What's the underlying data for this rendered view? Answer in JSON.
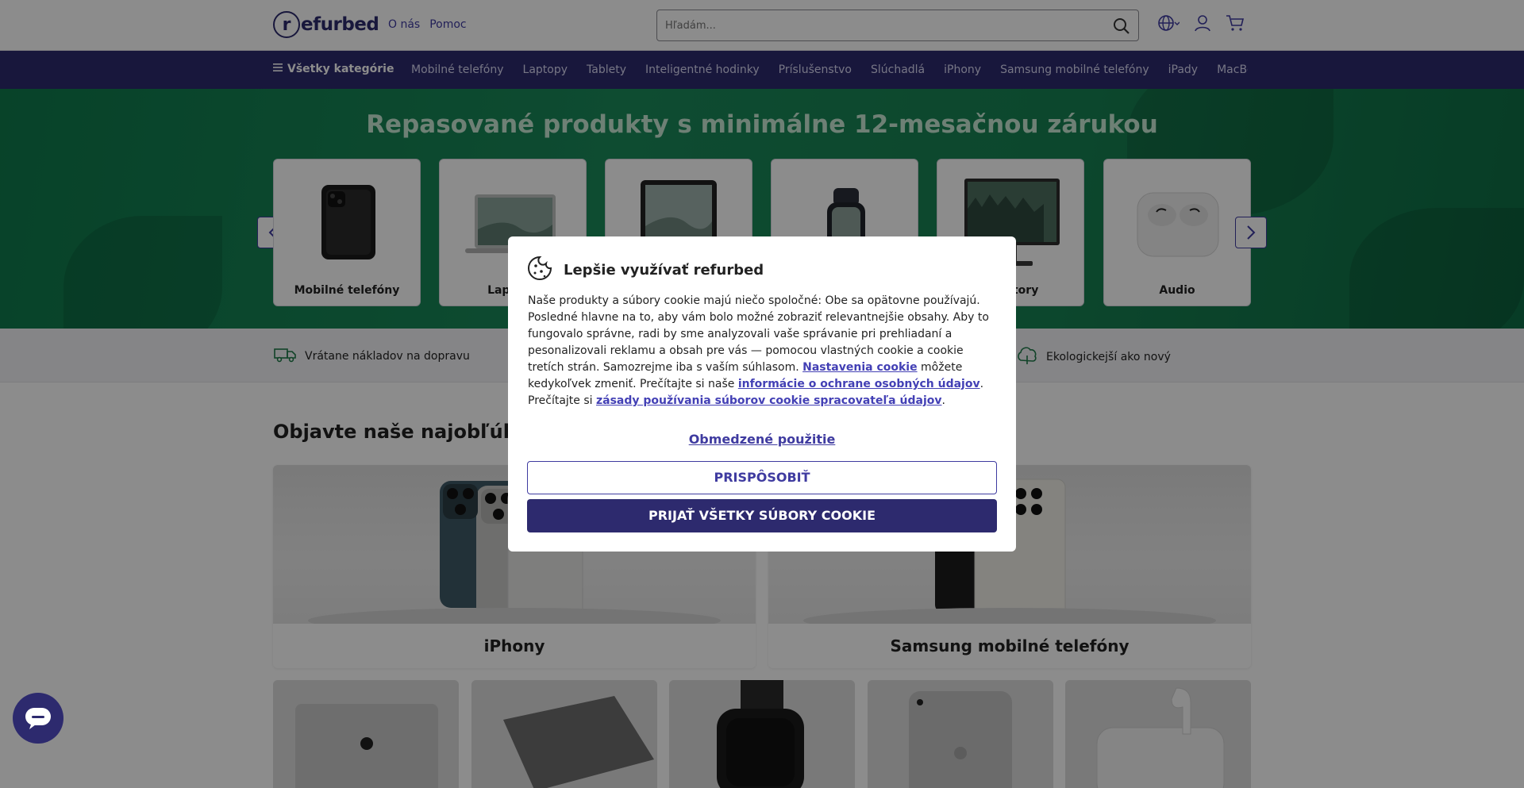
{
  "header": {
    "logo_mark": "r",
    "logo_text": "efurbed",
    "links": [
      "O nás",
      "Pomoc"
    ],
    "search_placeholder": "Hľadám..."
  },
  "nav": {
    "all_categories": "Všetky kategórie",
    "items": [
      "Mobilné telefóny",
      "Laptopy",
      "Tablety",
      "Inteligentné hodinky",
      "Príslušenstvo",
      "Slúchadlá",
      "iPhony",
      "Samsung mobilné telefóny",
      "iPady",
      "MacBooky"
    ]
  },
  "hero": {
    "title": "Repasované produkty s minimálne 12-mesačnou zárukou",
    "categories": [
      "Mobilné telefóny",
      "Laptopy",
      "",
      "",
      "Monitory",
      "Audio"
    ]
  },
  "usp": {
    "left": "Vrátane nákladov na dopravu",
    "right": "Ekologickejší ako nový"
  },
  "popular": {
    "title": "Objavte naše najobľúbenejšie kategórie",
    "cards": [
      "iPhony",
      "Samsung mobilné telefóny"
    ]
  },
  "cookie_modal": {
    "title": "Lepšie využívať refurbed",
    "body_1": "Naše produkty a súbory cookie majú niečo spoločné: Obe sa opätovne používajú. Posledné hlavne na to, aby vám bolo možné zobraziť relevantnejšie obsahy. Aby to fungovalo správne, radi by sme analyzovali vaše správanie pri prehliadaní a pesonalizovali reklamu a obsah pre vás — pomocou vlastných cookie a cookie tretích strán. Samozrejme iba s vaším súhlasom. ",
    "link_settings": "Nastavenia cookie",
    "body_2": " môžete kedykoľvek zmeniť. Prečítajte si naše ",
    "link_privacy": "informácie o ochrane osobných údajov",
    "body_3": ". Prečítajte si ",
    "link_processors": "zásady používania súborov cookie spracovateľa údajov",
    "body_4": ".",
    "limited_use": "Obmedzené použitie",
    "customize": "PRISPÔSOBIŤ",
    "accept_all": "PRIJAŤ VŠETKY SÚBORY COOKIE"
  }
}
